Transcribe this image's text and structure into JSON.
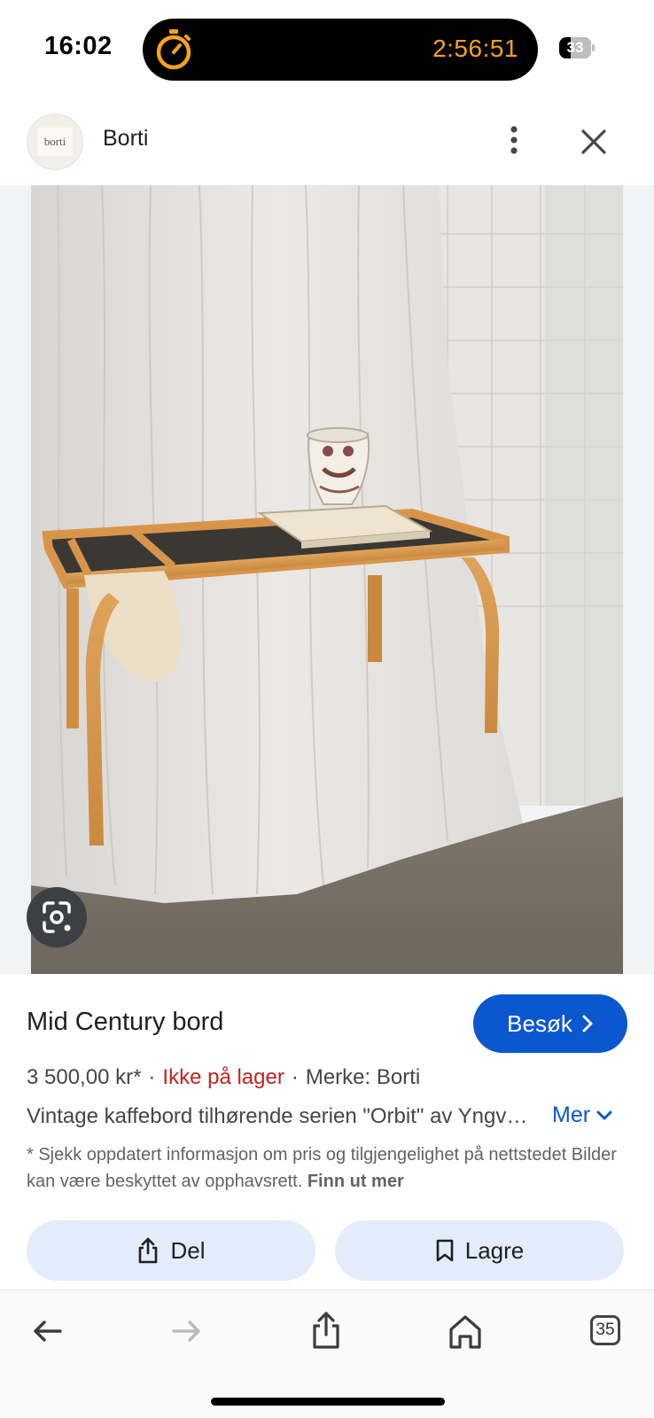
{
  "status_bar": {
    "time": "16:02",
    "timer": "2:56:51",
    "battery": "33"
  },
  "header": {
    "logo_text": "borti",
    "site_name": "Borti",
    "icons": [
      "more-vert-icon",
      "close-icon"
    ]
  },
  "product": {
    "title": "Mid Century bord",
    "visit_label": "Besøk",
    "price": "3 500,00 kr*",
    "stock": "Ikke på lager",
    "brand": "Merke: Borti",
    "description": "Vintage kaffebord tilhørende serien \"Orbit\" av Yngve Ekström",
    "more_label": "Mer",
    "disclaimer": "* Sjekk oppdatert informasjon om pris og tilgjengelighet på nettstedet Bilder kan være beskyttet av opphavsrett.",
    "find_out_more": "Finn ut mer"
  },
  "actions": {
    "share_label": "Del",
    "save_label": "Lagre"
  },
  "toolbar": {
    "tabs_count": "35",
    "icons": [
      "back-arrow-icon",
      "forward-arrow-icon",
      "share-icon",
      "home-icon",
      "tabs-icon"
    ]
  },
  "colors": {
    "accent_blue": "#0b57d0",
    "out_of_stock_red": "#c5221f",
    "pill_bg": "#e3ecfb",
    "timer_orange": "#f7a21b"
  }
}
